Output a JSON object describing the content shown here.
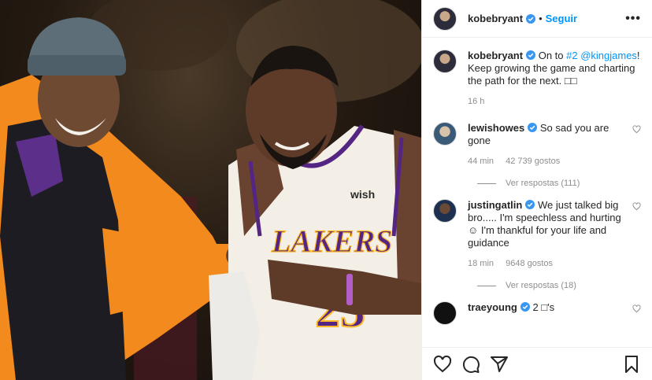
{
  "post": {
    "author": "kobebryant",
    "follow_label": "Seguir",
    "separator": "•",
    "caption_user": "kobebryant",
    "caption_text": "On to #2 @kingjames! Keep growing the game and charting the path for the next. □□",
    "caption_mention": "#2 @kingjames",
    "caption_time": "16 h"
  },
  "comments": [
    {
      "user": "lewishowes",
      "text": "So sad you are gone",
      "time": "44 min",
      "likes": "42 739 gostos",
      "replies": "Ver respostas (111)"
    },
    {
      "user": "justingatlin",
      "text": "We just talked big bro..... I'm speechless and hurting ☺ I'm thankful for your life and guidance",
      "time": "18 min",
      "likes": "9648 gostos",
      "replies": "Ver respostas (18)"
    },
    {
      "user": "traeyoung",
      "text": "2 □'s"
    }
  ],
  "icons": {
    "verified": "verified-badge-icon",
    "more": "more-options-icon",
    "heart": "heart-icon",
    "comment": "comment-icon",
    "share": "share-icon",
    "save": "bookmark-icon"
  },
  "colors": {
    "link": "#0095f6",
    "verified": "#3897f0",
    "muted": "#8e8e8e",
    "jersey": "#f3efe6",
    "lakers_purple": "#552583",
    "lakers_gold": "#fdb927",
    "hoodie": "#f28a1e"
  }
}
